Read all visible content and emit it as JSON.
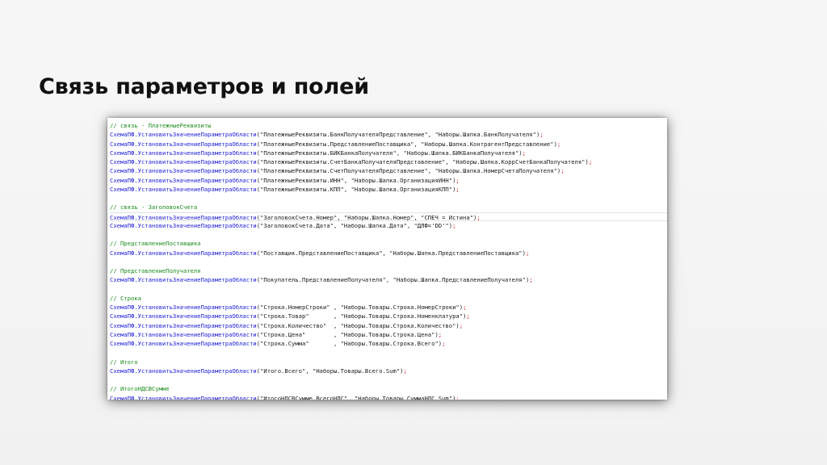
{
  "slide": {
    "title": "Связь параметров и полей"
  },
  "code": {
    "lines": [
      {
        "type": "comment",
        "text": "// связь - ПлатежныеРеквизиты"
      },
      {
        "type": "call",
        "fn": "СхемаПФ.УстановитьЗначениеПараметраОбласти",
        "args": "\"ПлатежныеРеквизиты.БанкПолучателяПредставление\", \"Наборы.Шапка.БанкПолучателя\""
      },
      {
        "type": "call",
        "fn": "СхемаПФ.УстановитьЗначениеПараметраОбласти",
        "args": "\"ПлатежныеРеквизиты.ПредставлениеПоставщика\", \"Наборы.Шапка.КонтрагентПредставление\""
      },
      {
        "type": "call",
        "fn": "СхемаПФ.УстановитьЗначениеПараметраОбласти",
        "args": "\"ПлатежныеРеквизиты.БИКБанкаПолучателя\", \"Наборы.Шапка.БИКБанкаПолучателя\""
      },
      {
        "type": "call",
        "fn": "СхемаПФ.УстановитьЗначениеПараметраОбласти",
        "args": "\"ПлатежныеРеквизиты.СчетБанкаПолучателяПредставление\", \"Наборы.Шапка.КоррСчетБанкаПолучателя\""
      },
      {
        "type": "call",
        "fn": "СхемаПФ.УстановитьЗначениеПараметраОбласти",
        "args": "\"ПлатежныеРеквизиты.СчетПолучателяПредставление\", \"Наборы.Шапка.НомерСчетаПолучателя\""
      },
      {
        "type": "call",
        "fn": "СхемаПФ.УстановитьЗначениеПараметраОбласти",
        "args": "\"ПлатежныеРеквизиты.ИНН\", \"Наборы.Шапка.ОрганизацияИНН\""
      },
      {
        "type": "call",
        "fn": "СхемаПФ.УстановитьЗначениеПараметраОбласти",
        "args": "\"ПлатежныеРеквизиты.КПП\", \"Наборы.Шапка.ОрганизацияКПП\""
      },
      {
        "type": "blank"
      },
      {
        "type": "comment",
        "text": "// связь - ЗаголовокСчета"
      },
      {
        "type": "call",
        "fn": "СхемаПФ.УстановитьЗначениеПараметраОбласти",
        "args": "\"ЗаголовокСчета.Номер\", \"Наборы.Шапка.Номер\", \"СПЕЧ = Истина\"",
        "current": true
      },
      {
        "type": "call",
        "fn": "СхемаПФ.УстановитьЗначениеПараметраОбласти",
        "args": "\"ЗаголовокСчета.Дата\", \"Наборы.Шапка.Дата\", \"ДЛФ='DD'\""
      },
      {
        "type": "blank"
      },
      {
        "type": "comment",
        "text": "// ПредставлениеПоставщика"
      },
      {
        "type": "call",
        "fn": "СхемаПФ.УстановитьЗначениеПараметраОбласти",
        "args": "\"Поставщик.ПредставлениеПоставщика\", \"Наборы.Шапка.ПредставлениеПоставщика\""
      },
      {
        "type": "blank"
      },
      {
        "type": "comment",
        "text": "// ПредставлениеПолучателя"
      },
      {
        "type": "call",
        "fn": "СхемаПФ.УстановитьЗначениеПараметраОбласти",
        "args": "\"Покупатель.ПредставлениеПолучателя\", \"Наборы.Шапка.ПредставлениеПолучателя\""
      },
      {
        "type": "blank"
      },
      {
        "type": "comment",
        "text": "// Строка"
      },
      {
        "type": "call",
        "fn": "СхемаПФ.УстановитьЗначениеПараметраОбласти",
        "args": "\"Строка.НомерСтроки\" , \"Наборы.Товары.Строка.НомерСтроки\""
      },
      {
        "type": "call",
        "fn": "СхемаПФ.УстановитьЗначениеПараметраОбласти",
        "args": "\"Строка.Товар\"       , \"Наборы.Товары.Строка.Номенклатура\""
      },
      {
        "type": "call",
        "fn": "СхемаПФ.УстановитьЗначениеПараметраОбласти",
        "args": "\"Строка.Количество\"  , \"Наборы.Товары.Строка.Количество\""
      },
      {
        "type": "call",
        "fn": "СхемаПФ.УстановитьЗначениеПараметраОбласти",
        "args": "\"Строка.Цена\"        , \"Наборы.Товары.Строка.Цена\""
      },
      {
        "type": "call",
        "fn": "СхемаПФ.УстановитьЗначениеПараметраОбласти",
        "args": "\"Строка.Сумма\"       , \"Наборы.Товары.Строка.Всего\""
      },
      {
        "type": "blank"
      },
      {
        "type": "comment",
        "text": "// Итого"
      },
      {
        "type": "call",
        "fn": "СхемаПФ.УстановитьЗначениеПараметраОбласти",
        "args": "\"Итого.Всего\", \"Наборы.Товары.Всего.Sum\""
      },
      {
        "type": "blank"
      },
      {
        "type": "comment",
        "text": "// ИтогоНДСВСумме"
      },
      {
        "type": "call",
        "fn": "СхемаПФ.УстановитьЗначениеПараметраОбласти",
        "args": "\"ИтогоНДСВСумме.ВсегоНДС\", \"Наборы.Товары.СуммаНДС.Sum\""
      }
    ]
  }
}
